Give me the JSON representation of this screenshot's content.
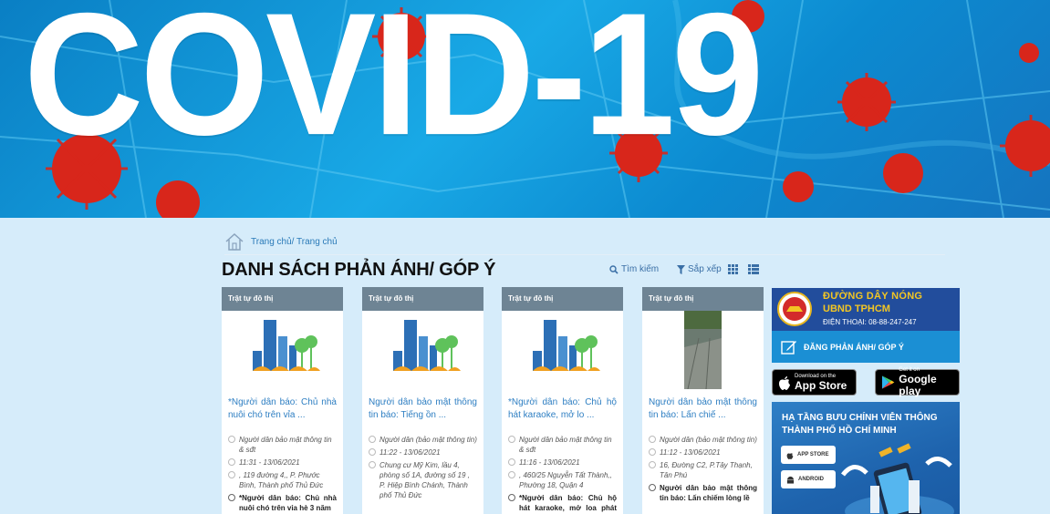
{
  "banner": {
    "title": "COVID-19"
  },
  "breadcrumb": {
    "text": "Trang chủ/ Trang chủ"
  },
  "page": {
    "title": "DANH SÁCH PHẢN ÁNH/ GÓP Ý"
  },
  "toolbar": {
    "search_label": "Tìm kiếm",
    "sort_label": "Sắp xếp"
  },
  "cards": [
    {
      "category": "Trật tự đô thị",
      "title": "*Người dân báo: Chủ nhà nuôi chó trên vỉa ...",
      "author": "Người dân bảo mật thông tin & sđt",
      "time": "11:31 - 13/06/2021",
      "address": ", 119 đường 4,, P. Phước Bình, Thành phố Thủ Đức",
      "description": "*Người dân báo: Chủ nhà nuôi chó trên vỉa hè 3 năm"
    },
    {
      "category": "Trật tự đô thị",
      "title": "Người dân bảo mật thông tin báo: Tiếng ồn ...",
      "author": "Người dân (bảo mật thông tin)",
      "time": "11:22 - 13/06/2021",
      "address": "Chung cư Mỹ Kim, lầu 4, phòng số 1A, đường số 19 , P. Hiệp Bình Chánh, Thành phố Thủ Đức",
      "description": ""
    },
    {
      "category": "Trật tự đô thị",
      "title": "*Người dân báo: Chủ hộ hát karaoke, mở lo ...",
      "author": "Người dân bảo mật thông tin & sđt",
      "time": "11:16 - 13/06/2021",
      "address": ", 460/25 Nguyễn Tất Thành,, Phường 18, Quận 4",
      "description": "*Người dân báo: Chủ hộ hát karaoke, mở loa phát nhạc"
    },
    {
      "category": "Trật tự đô thị",
      "title": "Người dân bảo mật thông tin báo: Lấn chiế ...",
      "author": "Người dân (bảo mật thông tin)",
      "time": "11:12 - 13/06/2021",
      "address": "16, Đường C2, P.Tây Thạnh, Tân Phú",
      "description": "Người dân bảo mật thông tin báo: Lấn chiếm lòng lề"
    }
  ],
  "sidebar": {
    "hotline_line1": "ĐƯỜNG DÂY NÓNG",
    "hotline_line2": "UBND TPHCM",
    "hotline_phone": "ĐIỆN THOẠI: 08-88-247-247",
    "report_label": "ĐĂNG PHẢN ÁNH/ GÓP Ý",
    "appstore_small": "Download on the",
    "appstore_big": "App Store",
    "googleplay_small": "Get it on",
    "googleplay_big": "Google play",
    "infra_title": "HẠ TẦNG BƯU CHÍNH VIỄN THÔNG THÀNH PHỐ HỒ CHÍ MINH",
    "infra_appstore": "APP STORE",
    "infra_android": "ANDROID"
  }
}
